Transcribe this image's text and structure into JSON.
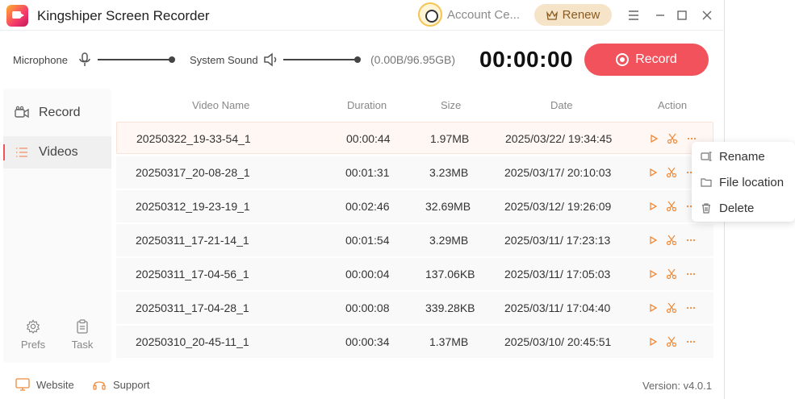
{
  "app": {
    "title": "Kingshiper Screen Recorder",
    "account_label": "Account Ce...",
    "renew_label": "Renew",
    "accent_color": "#f2525b",
    "brand_orange": "#f08a3a"
  },
  "controls": {
    "microphone_label": "Microphone",
    "microphone_icon": "microphone-icon",
    "system_sound_label": "System Sound",
    "system_sound_icon": "speaker-icon",
    "storage": "(0.00B/96.95GB)",
    "timer": "00:00:00",
    "record_button": "Record"
  },
  "sidebar": {
    "items": [
      {
        "label": "Record",
        "icon": "camera-icon",
        "active": false
      },
      {
        "label": "Videos",
        "icon": "list-icon",
        "active": true
      }
    ],
    "bottom": [
      {
        "label": "Prefs",
        "icon": "gear-icon"
      },
      {
        "label": "Task",
        "icon": "clipboard-icon"
      }
    ]
  },
  "table": {
    "columns": [
      "Video Name",
      "Duration",
      "Size",
      "Date",
      "Action"
    ],
    "rows": [
      {
        "name": "20250322_19-33-54_1",
        "duration": "00:00:44",
        "size": "1.97MB",
        "date": "2025/03/22/ 19:34:45"
      },
      {
        "name": "20250317_20-08-28_1",
        "duration": "00:01:31",
        "size": "3.23MB",
        "date": "2025/03/17/ 20:10:03"
      },
      {
        "name": "20250312_19-23-19_1",
        "duration": "00:02:46",
        "size": "32.69MB",
        "date": "2025/03/12/ 19:26:09"
      },
      {
        "name": "20250311_17-21-14_1",
        "duration": "00:01:54",
        "size": "3.29MB",
        "date": "2025/03/11/ 17:23:13"
      },
      {
        "name": "20250311_17-04-56_1",
        "duration": "00:00:04",
        "size": "137.06KB",
        "date": "2025/03/11/ 17:05:03"
      },
      {
        "name": "20250311_17-04-28_1",
        "duration": "00:00:08",
        "size": "339.28KB",
        "date": "2025/03/11/ 17:04:40"
      },
      {
        "name": "20250310_20-45-11_1",
        "duration": "00:00:34",
        "size": "1.37MB",
        "date": "2025/03/10/ 20:45:51"
      }
    ]
  },
  "context_menu": {
    "items": [
      {
        "label": "Rename",
        "icon": "rename-icon"
      },
      {
        "label": "File location",
        "icon": "folder-icon"
      },
      {
        "label": "Delete",
        "icon": "trash-icon"
      }
    ]
  },
  "footer": {
    "website": "Website",
    "support": "Support",
    "version": "Version: v4.0.1"
  }
}
